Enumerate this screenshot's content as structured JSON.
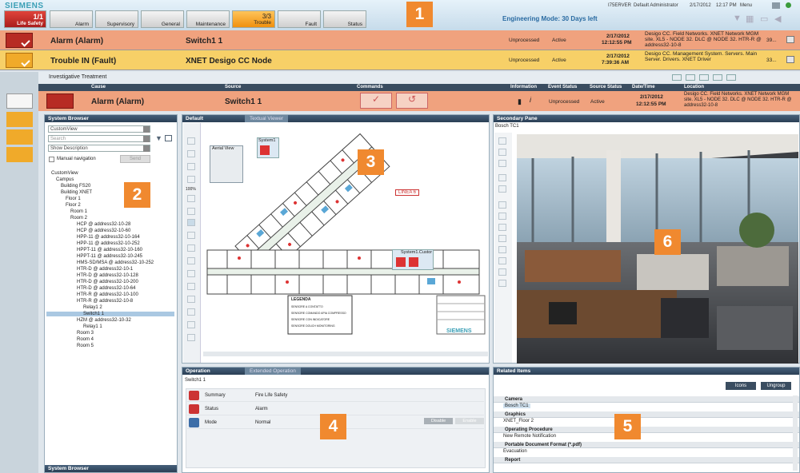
{
  "brand": "SIEMENS",
  "summary_bar": {
    "life_safety": {
      "count": "1/1",
      "label": "Life Safety"
    },
    "buttons": [
      "Alarm",
      "Supervisory",
      "General",
      "Maintenance"
    ],
    "trouble": {
      "count": "3/3",
      "label": "Trouble"
    },
    "buttons_right": [
      "Fault",
      "Status"
    ],
    "engineering_mode": "Engineering Mode: 30 Days left",
    "server": "I75ERVER",
    "user": "Default Administrator",
    "date": "2/17/2012",
    "time": "12:17 PM",
    "menu": "Menu"
  },
  "event_rows": [
    {
      "cause": "Alarm (Alarm)",
      "source": "Switch1 1",
      "state": "Unprocessed",
      "status": "Active",
      "date": "2/17/2012",
      "time": "12:12:55 PM",
      "location": "Desigo CC. Field Networks. XNET Network MGM site. XL5 - NODE 32. DLC @ NODE 32. HTR-R @ address32-10-8",
      "count": "39...",
      "color": "#f0a27e"
    },
    {
      "cause": "Trouble IN (Fault)",
      "source": "XNET Desigo CC Node",
      "state": "Unprocessed",
      "status": "Active",
      "date": "2/17/2012",
      "time": "7:39:36 AM",
      "location": "Desigo CC. Management System. Servers. Main Server. Drivers. XNET Driver",
      "count": "33...",
      "color": "#f7d067"
    }
  ],
  "callouts": [
    "1",
    "2",
    "3",
    "4",
    "5",
    "6"
  ],
  "investigative": {
    "title": "Investigative Treatment",
    "headers": [
      "Cause",
      "Source",
      "Commands",
      "Information",
      "Event Status",
      "Source Status",
      "Date/Time",
      "Location"
    ],
    "row": {
      "cause": "Alarm (Alarm)",
      "source": "Switch1 1",
      "event_status": "Unprocessed",
      "source_status": "Active",
      "date": "2/17/2012",
      "time": "12:12:55 PM",
      "location": "Desigo CC. Field Networks. XNET Network MGM site. XL5 - NODE 32. DLC @ NODE 32. HTR-R @ address32-10-8"
    }
  },
  "system_browser": {
    "title": "System Browser",
    "footer": "System Browser",
    "view": "CustomView",
    "search_placeholder": "Search",
    "description": "Show Description",
    "manual_nav": "Manual navigation",
    "send": "Send",
    "tree": [
      "CustomView",
      "Campus",
      "Building FS20",
      "Building XNET",
      "Floor 1",
      "Floor 2",
      "Room 1",
      "Room 2",
      "HCP @ address32-10-28",
      "HCP @ address32-10-60",
      "HPP-11 @ address32-10-164",
      "HPP-11 @ address32-10-252",
      "HPPT-11 @ address32-10-160",
      "HPPT-11 @ address32-10-245",
      "HMS-SD/MSA @ address32-10-252",
      "HTR-D @ address32-10-1",
      "HTR-D @ address32-10-128",
      "HTR-D @ address32-10-200",
      "HTR-D @ address32-10-64",
      "HTR-R @ address32-10-100",
      "HTR-R @ address32-10-8",
      "Relay1 2",
      "Switch1 1",
      "HZM @ address32-10-32",
      "Relay1 1",
      "Room 3",
      "Room 4",
      "Room 5"
    ]
  },
  "graphics": {
    "tabs": [
      "Default",
      "Textual Viewer"
    ],
    "aerial_view": "Aerial View",
    "system1": "System1",
    "label_linea": "LINEA 6",
    "system1_custom": "System1.Custor",
    "legend_title": "LEGENDA",
    "legend_items": [
      "SENSORE A CONTATTO",
      "SENSORE COMANDO APIA COMPRESSO",
      "SENSORE CON INDICATORE",
      "SENSORE DOUCH MONITORING"
    ],
    "siemens_stamp": "SIEMENS",
    "zoom": "100%"
  },
  "secondary": {
    "title": "Secondary Pane",
    "camera": "Bosch TC1"
  },
  "operation": {
    "tabs": [
      "Operation",
      "Extended Operation"
    ],
    "object": "Switch1 1",
    "rows": [
      {
        "label": "Summary",
        "value": "Fire Life Safety"
      },
      {
        "label": "Status",
        "value": "Alarm"
      },
      {
        "label": "Mode",
        "value": "Normal"
      }
    ],
    "disable": "Disable",
    "enable": "Enable"
  },
  "related": {
    "title": "Related Items",
    "icons_btn": "Icons",
    "ungroup_btn": "Ungroup",
    "groups": [
      {
        "h": "Camera",
        "item": "Bosch TC1"
      },
      {
        "h": "Graphics",
        "item": "XNET_Floor 2"
      },
      {
        "h": "Operating Procedure",
        "item": "New Remote Notification"
      },
      {
        "h": "Portable Document Format (*.pdf)",
        "item": "Evacuation"
      },
      {
        "h": "Report",
        "item": ""
      }
    ]
  }
}
